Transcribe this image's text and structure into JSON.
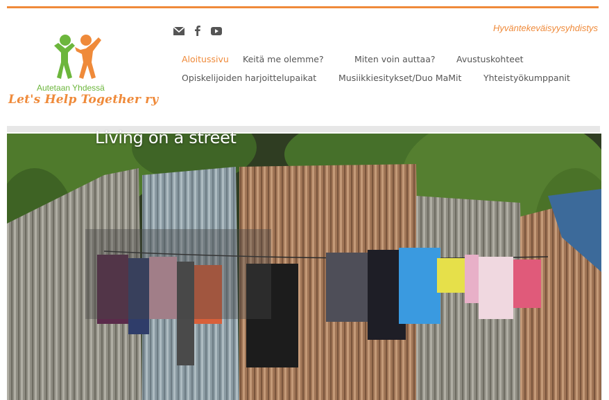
{
  "branding": {
    "logo_tagline": "Autetaan Yhdessä",
    "logo_title": "Let's Help Together ry",
    "org_type": "Hyväntekeväisyysyhdistys",
    "accent_color": "#ef8a3a",
    "green_color": "#6cb63c"
  },
  "social": {
    "icons": [
      "mail-icon",
      "facebook-icon",
      "youtube-icon"
    ]
  },
  "nav": {
    "row1": [
      "Aloitussivu",
      "Keitä me olemme?",
      "Miten voin auttaa?",
      "Avustuskohteet"
    ],
    "row2": [
      "Opiskelijoiden harjoittelupaikat",
      "Musiikkiesitykset/Duo MaMit",
      "Yhteistyökumppanit"
    ],
    "active": "Aloitussivu"
  },
  "hero": {
    "caption": "Living on a street"
  }
}
